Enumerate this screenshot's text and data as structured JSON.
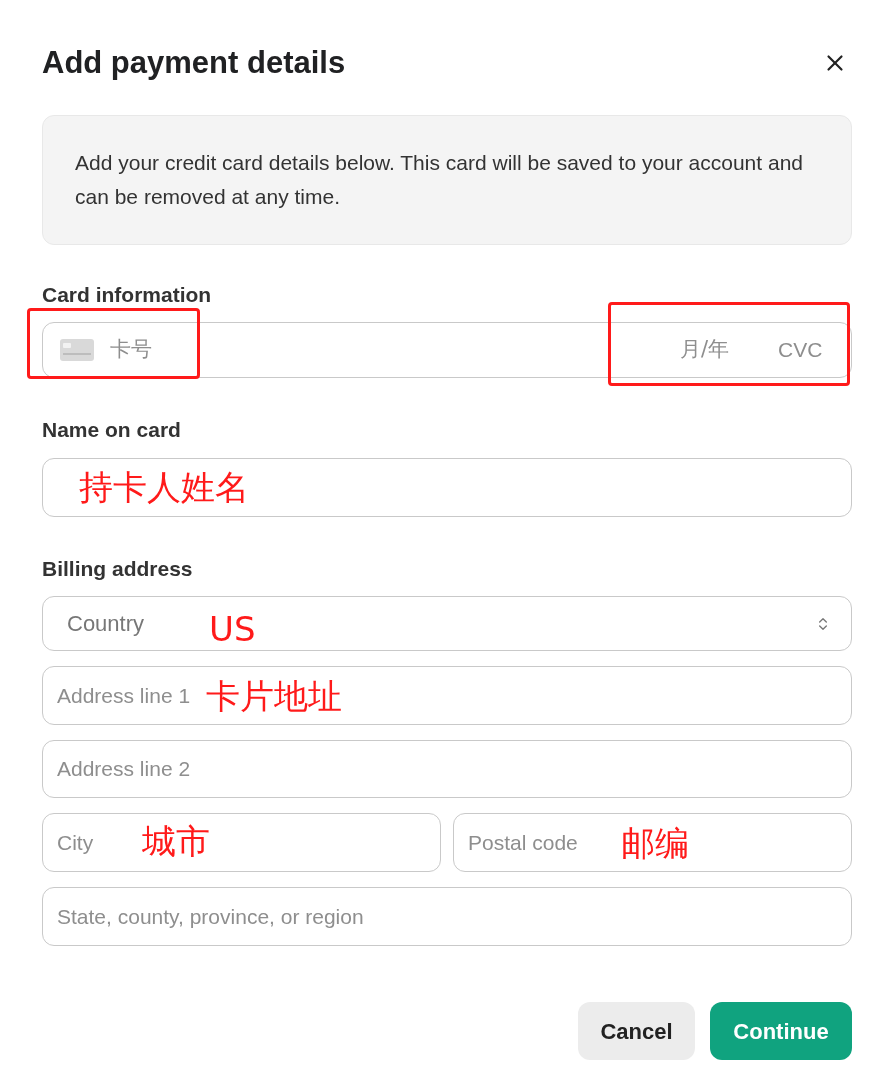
{
  "dialog": {
    "title": "Add payment details"
  },
  "notice": "Add your credit card details below. This card will be saved to your account and can be removed at any time.",
  "card": {
    "label": "Card information",
    "number_placeholder": "卡号",
    "expiry_placeholder": "月/年",
    "cvc_placeholder": "CVC"
  },
  "name": {
    "label": "Name on card",
    "annotation": "持卡人姓名"
  },
  "billing": {
    "label": "Billing address",
    "country": {
      "placeholder": "Country",
      "annotation": "US"
    },
    "address_line_1": {
      "placeholder": "Address line 1",
      "annotation": "卡片地址"
    },
    "address_line_2": {
      "placeholder": "Address line 2"
    },
    "city": {
      "placeholder": "City",
      "annotation": "城市"
    },
    "postal_code": {
      "placeholder": "Postal code",
      "annotation": "邮编"
    },
    "state": {
      "placeholder": "State, county, province, or region"
    }
  },
  "buttons": [
    {
      "label": "Cancel",
      "kind": "secondary"
    },
    {
      "label": "Continue",
      "kind": "primary"
    }
  ]
}
